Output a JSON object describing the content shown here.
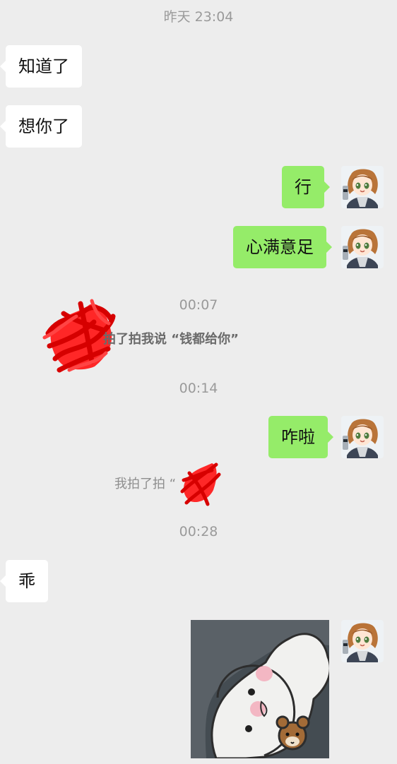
{
  "chat": {
    "messages": {
      "time_1": "昨天 23:04",
      "left_1": "知道了",
      "left_2": "想你了",
      "right_1": "行",
      "right_2": "心满意足",
      "time_2": "00:07",
      "pat_text": "拍了拍我说 “钱都给你”",
      "time_3": "00:14",
      "right_3": "咋啦",
      "self_pat_text": "我拍了拍 “",
      "time_4": "00:28",
      "left_3": "乖"
    }
  },
  "icons": {
    "avatar": "anime-girl-avatar-icon",
    "sticker": "white-seal-sticker-icon",
    "redaction": "red-scribble-redaction-icon"
  },
  "colors": {
    "background": "#ededed",
    "incoming_bubble": "#ffffff",
    "outgoing_bubble": "#95ec69",
    "timestamp_text": "#9a9a9a",
    "redaction": "#ff0000"
  }
}
